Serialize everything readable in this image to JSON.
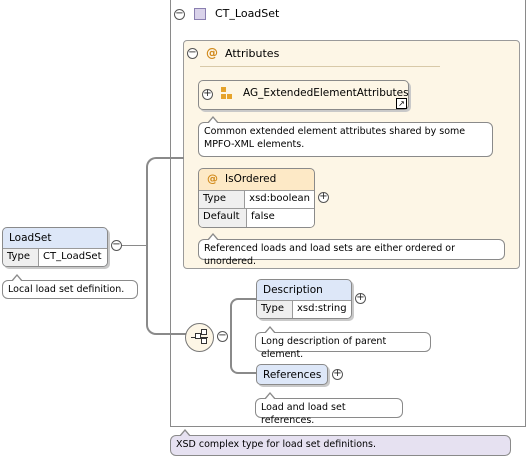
{
  "complex_type": {
    "name": "CT_LoadSet",
    "doc": "XSD complex type for load set definitions."
  },
  "attributes": {
    "title": "Attributes",
    "group_name": "AG_ExtendedElementAttributes",
    "group_doc": "Common extended element attributes shared by some MPFO-XML elements.",
    "isordered": {
      "name": "IsOrdered",
      "type_key": "Type",
      "type_val": "xsd:boolean",
      "default_key": "Default",
      "default_val": "false",
      "doc": "Referenced loads and load sets are either ordered or unordered."
    }
  },
  "element": {
    "name": "LoadSet",
    "type_key": "Type",
    "type_val": "CT_LoadSet",
    "doc": "Local load set definition."
  },
  "description": {
    "name": "Description",
    "type_key": "Type",
    "type_val": "xsd:string",
    "doc": "Long description of parent element."
  },
  "references": {
    "name": "References",
    "doc": "Load and load set references."
  },
  "symbols": {
    "at": "@",
    "minus": "−",
    "plus": "+"
  }
}
